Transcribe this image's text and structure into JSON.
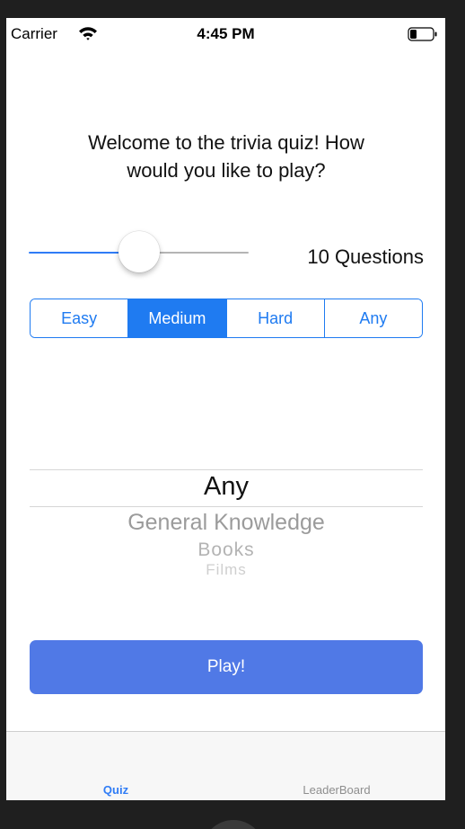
{
  "status_bar": {
    "carrier": "Carrier",
    "time": "4:45 PM",
    "wifi_icon": "wifi-icon",
    "battery_icon": "battery-icon"
  },
  "welcome": {
    "line1": "Welcome to the trivia quiz! How",
    "line2": "would you like to play?"
  },
  "slider": {
    "value_fraction": 0.5,
    "label": "10 Questions"
  },
  "difficulty": {
    "options": [
      "Easy",
      "Medium",
      "Hard",
      "Any"
    ],
    "selected": "Medium"
  },
  "category_picker": {
    "selected": "Any",
    "items": [
      "General Knowledge",
      "Books",
      "Films"
    ]
  },
  "play_button": {
    "label": "Play!"
  },
  "tab_bar": {
    "tabs": [
      {
        "label": "Quiz",
        "selected": true
      },
      {
        "label": "LeaderBoard",
        "selected": false
      }
    ]
  },
  "colors": {
    "accent": "#1f7bf1",
    "play_button": "#5079e6",
    "background": "#ffffff",
    "frame": "#1f1f1f"
  }
}
